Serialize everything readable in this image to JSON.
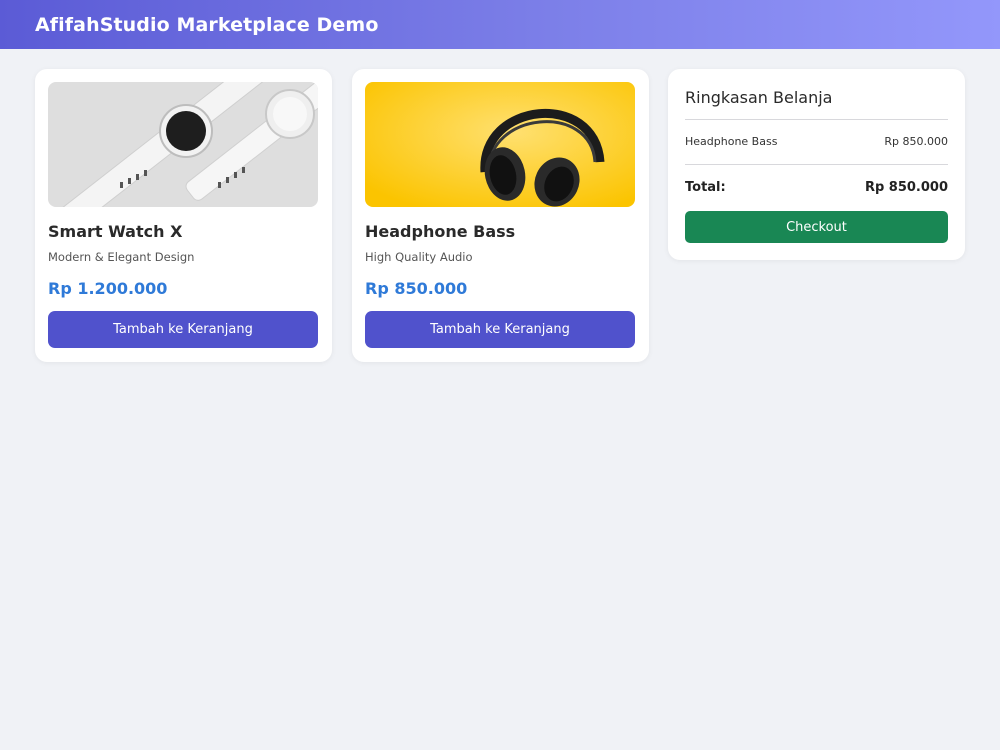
{
  "header": {
    "title": "AfifahStudio Marketplace Demo"
  },
  "products": [
    {
      "name": "Smart Watch X",
      "description": "Modern & Elegant Design",
      "price": "Rp 1.200.000",
      "button_label": "Tambah ke Keranjang",
      "image_icon": "smartwatch-photo"
    },
    {
      "name": "Headphone Bass",
      "description": "High Quality Audio",
      "price": "Rp 850.000",
      "button_label": "Tambah ke Keranjang",
      "image_icon": "headphone-photo"
    }
  ],
  "summary": {
    "title": "Ringkasan Belanja",
    "items": [
      {
        "name": "Headphone Bass",
        "price": "Rp 850.000"
      }
    ],
    "total_label": "Total:",
    "total_value": "Rp 850.000",
    "checkout_label": "Checkout"
  },
  "colors": {
    "header_gradient_start": "#5b5bd6",
    "header_gradient_end": "#9397fb",
    "primary_button": "#5052cc",
    "price": "#2f7ad8",
    "checkout_button": "#198754",
    "background": "#f0f2f6"
  }
}
